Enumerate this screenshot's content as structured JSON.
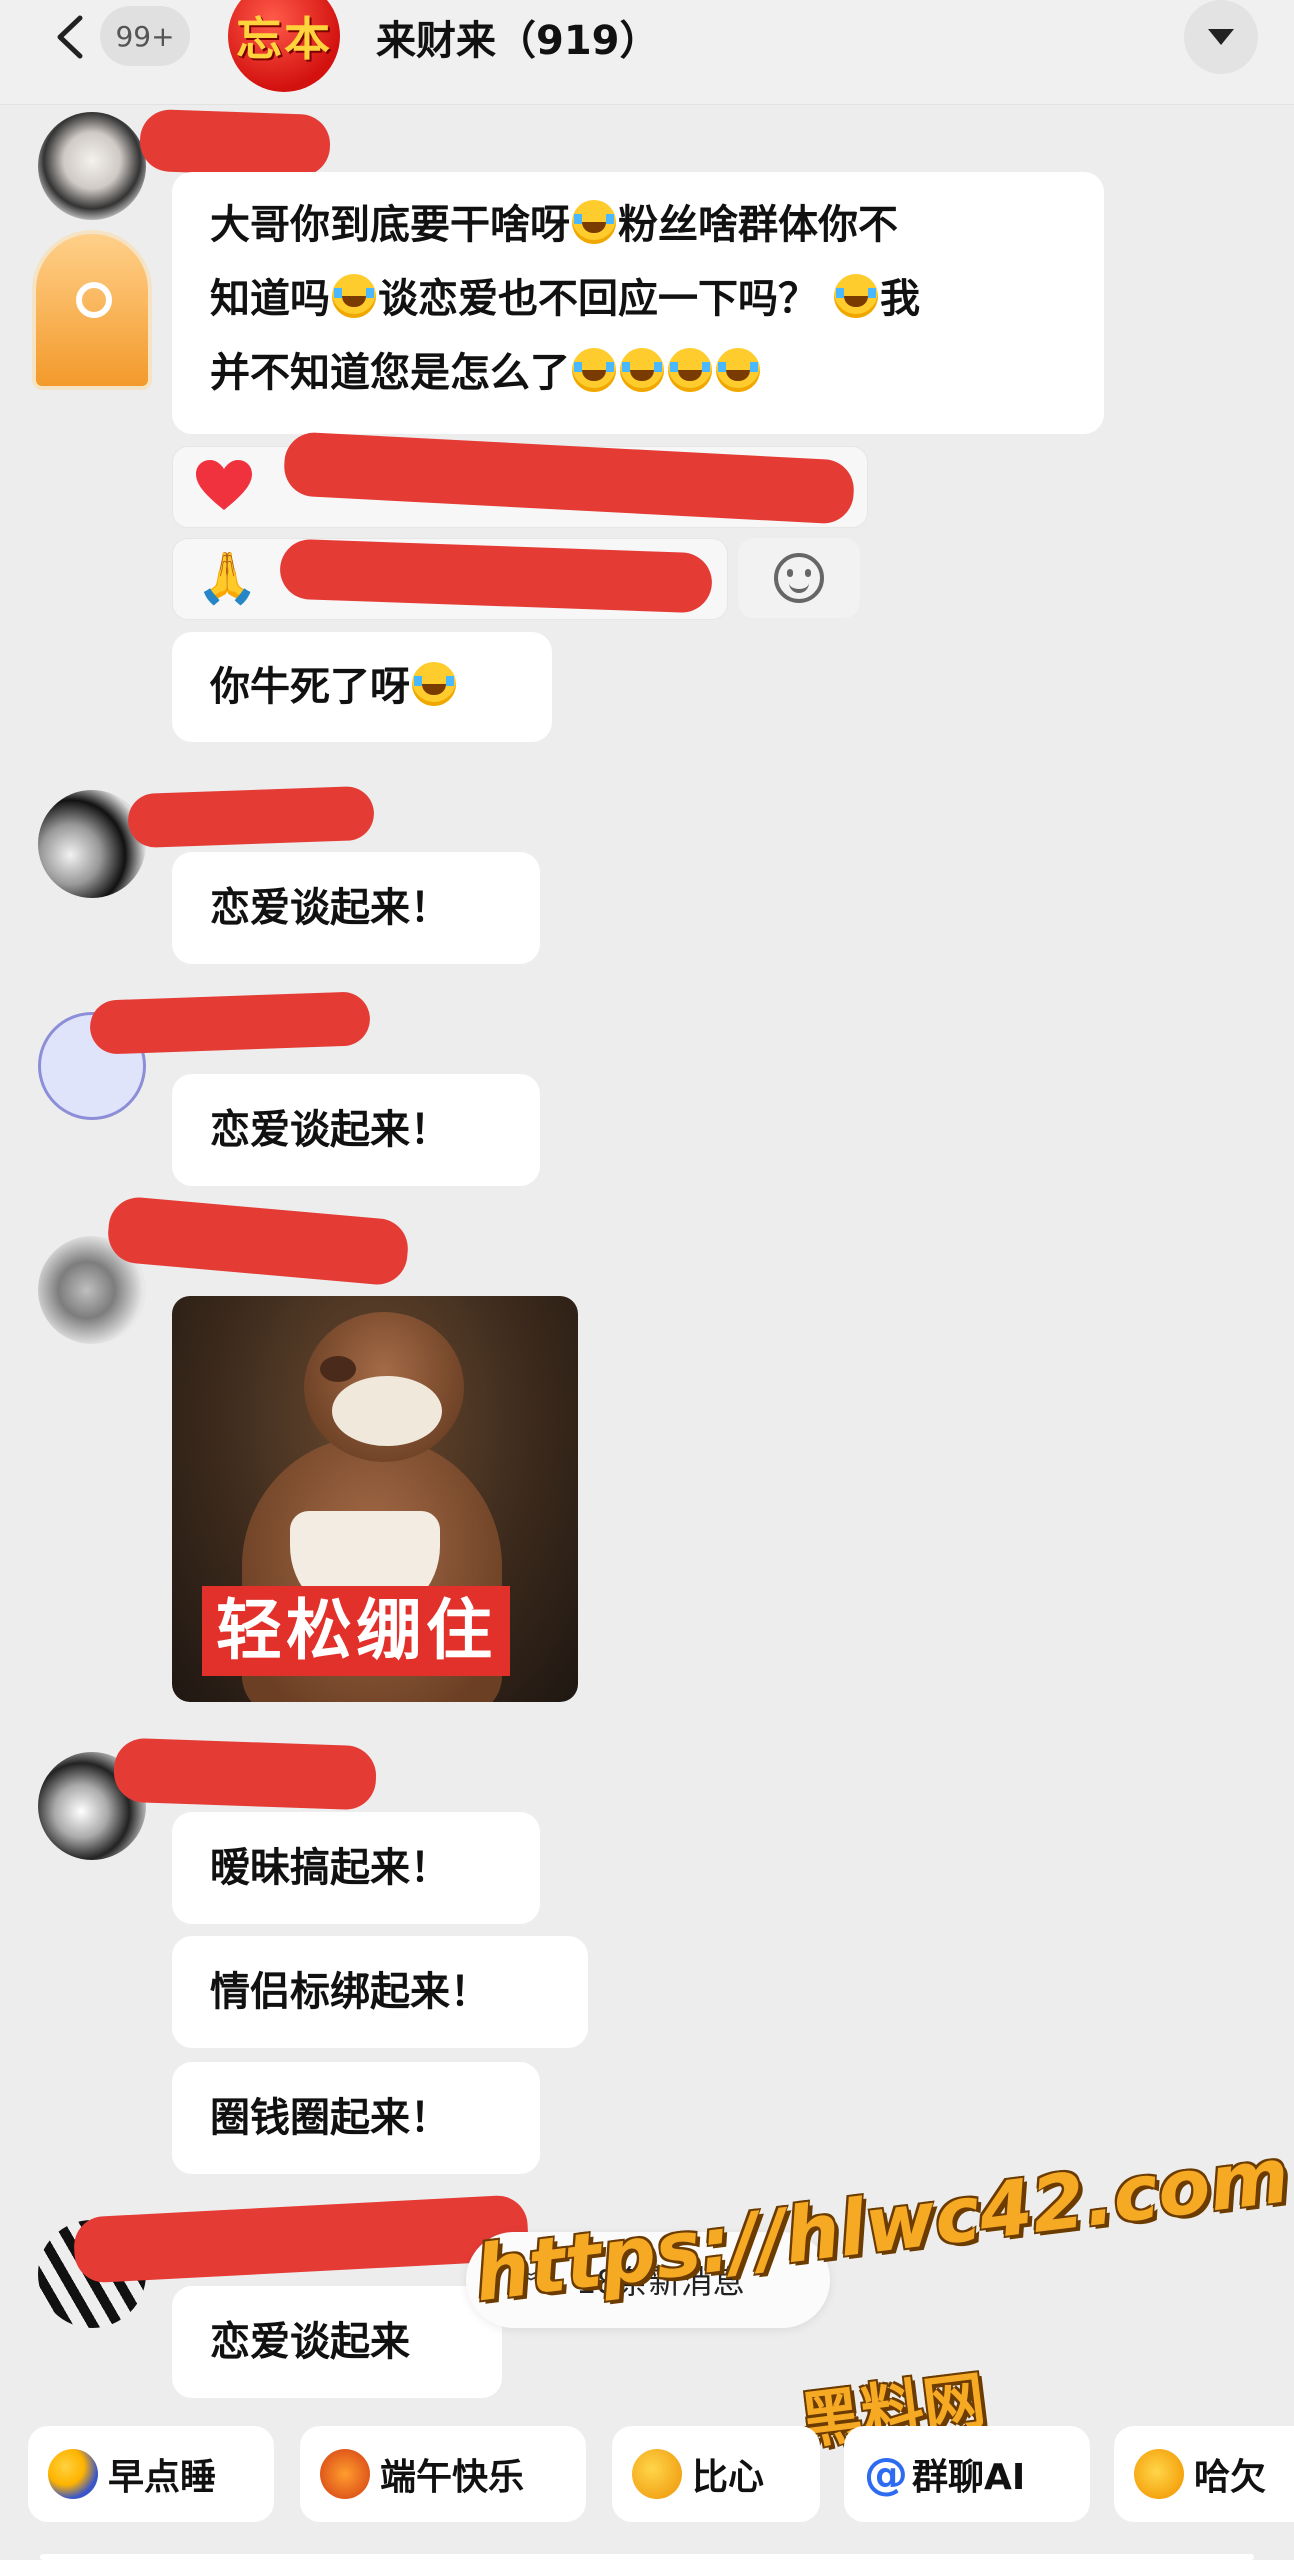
{
  "header": {
    "unread_count": "99+",
    "group_avatar_text": "忘本",
    "title": "来财来（919）"
  },
  "messages": {
    "m1": {
      "line1": "大哥你到底要干啥呀",
      "line1b": "粉丝啥群体你不",
      "line2": "知道吗",
      "line2b": "谈恋爱也不回应一下吗？",
      "line2c": "我",
      "line3": "并不知道您是怎么了"
    },
    "m2": "你牛死了呀",
    "m3": "恋爱谈起来！",
    "m4": "恋爱谈起来！",
    "sticker_caption": "轻松绷住",
    "m5a": "暧昧搞起来！",
    "m5b": "情侣标绑起来！",
    "m5c": "圈钱圈起来！",
    "m6": "恋爱谈起来"
  },
  "new_messages_label": "18条新消息",
  "watermark": {
    "url": "https://hlwc42.com",
    "site": "黑料网"
  },
  "quick_replies": [
    {
      "label": "早点睡",
      "icon": "moon-icon"
    },
    {
      "label": "端午快乐",
      "icon": "dragon-icon"
    },
    {
      "label": "比心",
      "icon": "heart-hands-icon"
    },
    {
      "label": "群聊AI",
      "icon": "at-icon"
    },
    {
      "label": "哈欠",
      "icon": "yawn-icon"
    }
  ],
  "colors": {
    "background": "#ededed",
    "bubble": "#ffffff",
    "redaction": "#e53b35",
    "watermark": "#f6a923"
  }
}
